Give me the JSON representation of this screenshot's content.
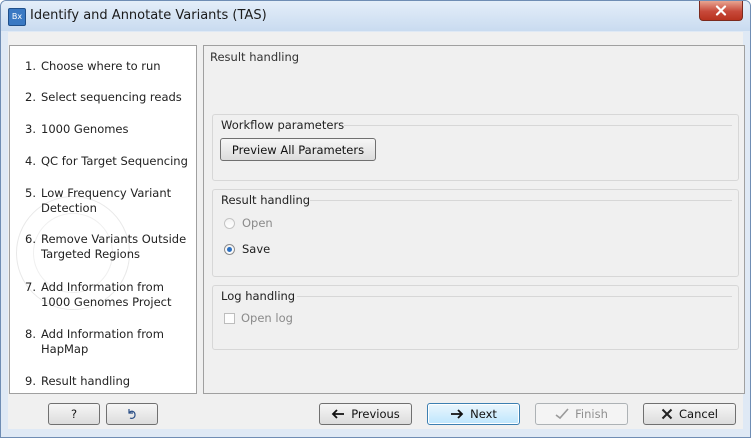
{
  "window": {
    "title": "Identify and Annotate Variants (TAS)",
    "app_icon": "Bx"
  },
  "steps": [
    {
      "num": "1.",
      "label": "Choose where to run"
    },
    {
      "num": "2.",
      "label": "Select sequencing reads"
    },
    {
      "num": "3.",
      "label": "1000 Genomes"
    },
    {
      "num": "4.",
      "label": "QC for Target Sequencing"
    },
    {
      "num": "5.",
      "label": "Low Frequency Variant Detection"
    },
    {
      "num": "6.",
      "label": "Remove Variants Outside Targeted Regions"
    },
    {
      "num": "7.",
      "label": "Add Information from 1000 Genomes Project"
    },
    {
      "num": "8.",
      "label": "Add Information from HapMap"
    },
    {
      "num": "9.",
      "label": "Result handling"
    }
  ],
  "panel": {
    "title": "Result handling",
    "workflow_group": {
      "title": "Workflow parameters",
      "preview_button": "Preview All Parameters"
    },
    "result_group": {
      "title": "Result handling",
      "open_label": "Open",
      "save_label": "Save",
      "selected": "Save"
    },
    "log_group": {
      "title": "Log handling",
      "open_log_label": "Open log",
      "open_log_checked": false
    }
  },
  "buttons": {
    "help": "?",
    "previous": "Previous",
    "next": "Next",
    "finish": "Finish",
    "cancel": "Cancel"
  },
  "icons": {
    "close": "close-icon",
    "reset": "reset-icon",
    "previous": "arrow-left-icon",
    "next": "arrow-right-icon",
    "finish": "checkmark-icon",
    "cancel": "x-icon"
  },
  "colors": {
    "title_bar": "#c9dbf0",
    "close_button": "#c7493a",
    "radio_selected": "#2c6fc0",
    "focus_button_border": "#3c7fb1"
  }
}
